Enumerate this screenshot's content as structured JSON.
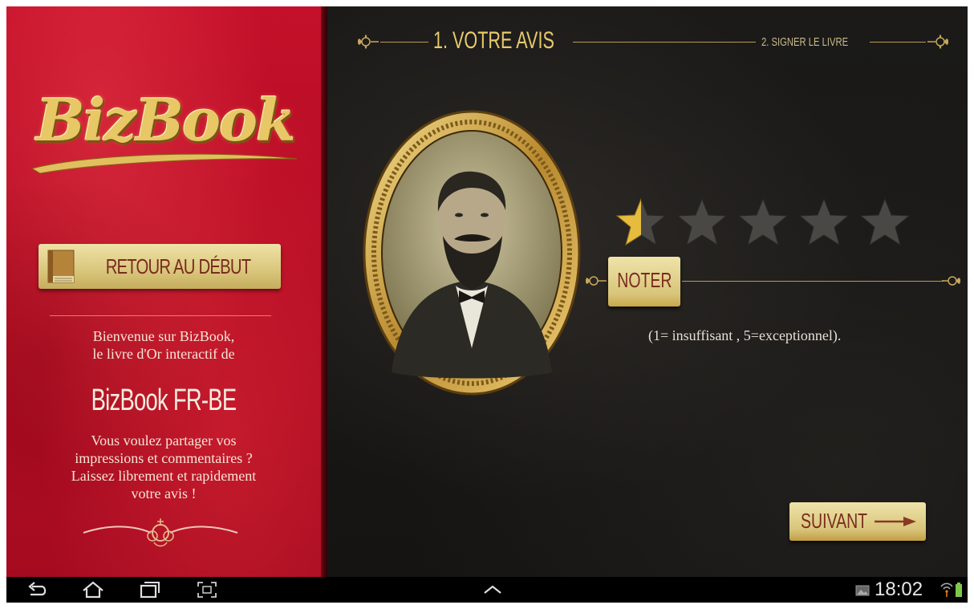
{
  "app": {
    "logo_text": "BizBook",
    "back_button_label": "RETOUR AU DÉBUT",
    "welcome_line1": "Bienvenue sur BizBook,",
    "welcome_line2": "le livre d'Or interactif de",
    "book_name": "BizBook FR-BE",
    "invite_lines": [
      "Vous voulez partager vos",
      "impressions et commentaires ?",
      "Laissez librement et rapidement",
      "votre avis !"
    ]
  },
  "steps": {
    "step1": "1. VOTRE AVIS",
    "step2": "2. SIGNER LE LIVRE",
    "active_step": 1
  },
  "rating": {
    "max": 5,
    "value": 0.5,
    "submit_label": "NOTER",
    "scale_text": "(1= insuffisant , 5=exceptionnel)."
  },
  "navigation": {
    "next_label": "SUIVANT"
  },
  "system_bar": {
    "clock": "18:02",
    "icons": [
      "back-icon",
      "home-icon",
      "recent-apps-icon",
      "screenshot-icon",
      "up-chevron-icon",
      "gallery-notification-icon",
      "wifi-icon",
      "battery-icon"
    ]
  },
  "colors": {
    "sidebar_red": "#b30d24",
    "gold": "#e8c96d",
    "button_gold": "#d8c57b",
    "button_text": "#7a2c1d",
    "background_dark": "#181716"
  }
}
